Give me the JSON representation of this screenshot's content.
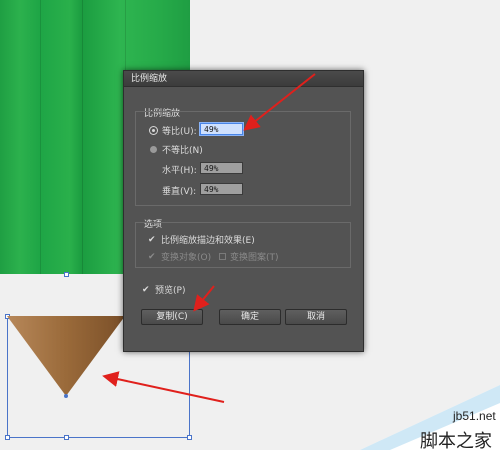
{
  "dialog": {
    "title": "比例缩放",
    "scale_group": {
      "label": "比例缩放",
      "uniform": {
        "label": "等比(U):",
        "value": "49%",
        "selected": true
      },
      "non_uniform": {
        "label": "不等比(N)",
        "selected": false
      },
      "horizontal": {
        "label": "水平(H):",
        "value": "49%"
      },
      "vertical": {
        "label": "垂直(V):",
        "value": "49%"
      }
    },
    "options_group": {
      "label": "选项",
      "scale_strokes": {
        "label": "比例缩放描边和效果(E)",
        "checked": true
      },
      "transform_objects": {
        "label": "变换对象(O)",
        "checked": true,
        "enabled": false
      },
      "transform_patterns": {
        "label": "变换图案(T)",
        "checked": false,
        "enabled": false
      }
    },
    "preview": {
      "label": "预览(P)",
      "checked": true
    },
    "buttons": {
      "copy": "复制(C)",
      "ok": "确定",
      "cancel": "取消"
    }
  },
  "watermark": {
    "site": "jb51.net",
    "name": "脚本之家"
  },
  "colors": {
    "pencil_green": "#26aa49",
    "pencil_tip": "#9a6a3a",
    "arrow_red": "#e0201c",
    "selection_blue": "#4a74c9",
    "dialog_bg": "#535353"
  }
}
